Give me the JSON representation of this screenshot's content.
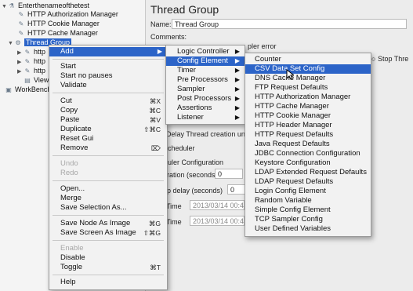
{
  "tree": {
    "root": "Enterthenameofthetest",
    "items": [
      "HTTP Authorization Manager",
      "HTTP Cookie Manager",
      "HTTP Cache Manager",
      "Thread Group"
    ],
    "children": [
      "http",
      "http",
      "http",
      "View"
    ],
    "workbench": "WorkBench"
  },
  "panel": {
    "title": "Thread Group",
    "name_label": "Name:",
    "name_value": "Thread Group",
    "comments_label": "Comments:",
    "sampler_error_text": "pler error",
    "stop_text": "Stop Thre",
    "delay_text": "Delay Thread creation unt",
    "scheduler_text": "Scheduler",
    "scheduler_config": "eduler Configuration",
    "duration_label": "uration (seconds)",
    "duration_value": "0",
    "startup_label": "up delay (seconds)",
    "startup_value": "0",
    "start_label": "Time",
    "start_value": "2013/03/14 00:44",
    "end_label": "Time",
    "end_value": "2013/03/14 00:44"
  },
  "context_menu": {
    "items": [
      {
        "label": "Add",
        "type": "sub",
        "highlight": true
      },
      {
        "label": "Start"
      },
      {
        "label": "Start no pauses"
      },
      {
        "label": "Validate"
      },
      {
        "label": "Cut",
        "shortcut": "⌘X"
      },
      {
        "label": "Copy",
        "shortcut": "⌘C"
      },
      {
        "label": "Paste",
        "shortcut": "⌘V"
      },
      {
        "label": "Duplicate",
        "shortcut": "⇧⌘C"
      },
      {
        "label": "Reset Gui"
      },
      {
        "label": "Remove",
        "shortcut": "⌦"
      },
      {
        "label": "Undo",
        "disabled": true
      },
      {
        "label": "Redo",
        "disabled": true
      },
      {
        "label": "Open..."
      },
      {
        "label": "Merge"
      },
      {
        "label": "Save Selection As..."
      },
      {
        "label": "Save Node As Image",
        "shortcut": "⌘G"
      },
      {
        "label": "Save Screen As Image",
        "shortcut": "⇧⌘G"
      },
      {
        "label": "Enable",
        "disabled": true
      },
      {
        "label": "Disable"
      },
      {
        "label": "Toggle",
        "shortcut": "⌘T"
      },
      {
        "label": "Help"
      }
    ]
  },
  "add_menu": {
    "items": [
      "Logic Controller",
      "Config Element",
      "Timer",
      "Pre Processors",
      "Sampler",
      "Post Processors",
      "Assertions",
      "Listener"
    ]
  },
  "config_menu": {
    "items": [
      "Counter",
      "CSV Data Set Config",
      "DNS Cache Manager",
      "FTP Request Defaults",
      "HTTP Authorization Manager",
      "HTTP Cache Manager",
      "HTTP Cookie Manager",
      "HTTP Header Manager",
      "HTTP Request Defaults",
      "Java Request Defaults",
      "JDBC Connection Configuration",
      "Keystore Configuration",
      "LDAP Extended Request Defaults",
      "LDAP Request Defaults",
      "Login Config Element",
      "Random Variable",
      "Simple Config Element",
      "TCP Sampler Config",
      "User Defined Variables"
    ]
  },
  "colors": {
    "highlight": "#2c64c8",
    "menu_bg": "#f2f2f2"
  }
}
